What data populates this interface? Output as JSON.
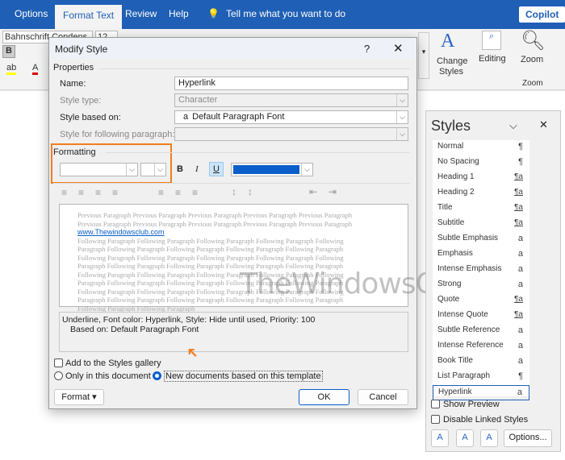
{
  "ribbon": {
    "tabs": [
      "Options",
      "Format Text",
      "Review",
      "Help"
    ],
    "tell_me": "Tell me what you want to do",
    "copilot": "Copilot",
    "font": "Bahnschrift Condens",
    "size": "12",
    "change_styles": "Change Styles",
    "editing": "Editing",
    "zoom": "Zoom",
    "zoom_group": "Zoom"
  },
  "dialog": {
    "title": "Modify Style",
    "help": "?",
    "properties": "Properties",
    "name_label": "Name:",
    "name_value": "Hyperlink",
    "type_label": "Style type:",
    "type_value": "Character",
    "based_label": "Style based on:",
    "based_value": "Default Paragraph Font",
    "based_icon": "a",
    "following_label": "Style for following paragraph:",
    "formatting": "Formatting",
    "bold": "B",
    "italic": "I",
    "underline": "U",
    "font_color": "#0a5ec9",
    "preview_prev": "Previous Paragraph Previous Paragraph Previous Paragraph Previous Paragraph Previous Paragraph Previous Paragraph Previous Paragraph Previous Paragraph Previous Paragraph Previous Paragraph",
    "preview_link": "www.Thewindowsclub.com",
    "preview_follow": "Following Paragraph Following Paragraph Following Paragraph Following Paragraph Following Paragraph Following Paragraph Following Paragraph Following Paragraph Following Paragraph Following Paragraph Following Paragraph Following Paragraph Following Paragraph Following Paragraph Following Paragraph Following Paragraph Following Paragraph Following Paragraph Following Paragraph Following Paragraph Following Paragraph Following Paragraph Following Paragraph Following Paragraph Following Paragraph Following Paragraph Following Paragraph Following Paragraph Following Paragraph Following Paragraph Following Paragraph Following Paragraph Following Paragraph Following Paragraph Following Paragraph Following Paragraph Following Paragraph Following Paragraph",
    "desc_line1": "Underline, Font color: Hyperlink, Style: Hide until used, Priority: 100",
    "desc_line2": "Based on: Default Paragraph Font",
    "add_gallery": "Add to the Styles gallery",
    "only_doc": "Only in this document",
    "new_docs": "New documents based on this template",
    "format": "Format",
    "ok": "OK",
    "cancel": "Cancel"
  },
  "watermark": "TheWindowsClub.com",
  "styles_pane": {
    "title": "Styles",
    "items": [
      {
        "name": "Normal",
        "glyph": "¶"
      },
      {
        "name": "No Spacing",
        "glyph": "¶"
      },
      {
        "name": "Heading 1",
        "glyph": "¶a"
      },
      {
        "name": "Heading 2",
        "glyph": "¶a"
      },
      {
        "name": "Title",
        "glyph": "¶a"
      },
      {
        "name": "Subtitle",
        "glyph": "¶a"
      },
      {
        "name": "Subtle Emphasis",
        "glyph": "a"
      },
      {
        "name": "Emphasis",
        "glyph": "a"
      },
      {
        "name": "Intense Emphasis",
        "glyph": "a"
      },
      {
        "name": "Strong",
        "glyph": "a"
      },
      {
        "name": "Quote",
        "glyph": "¶a"
      },
      {
        "name": "Intense Quote",
        "glyph": "¶a"
      },
      {
        "name": "Subtle Reference",
        "glyph": "a"
      },
      {
        "name": "Intense Reference",
        "glyph": "a"
      },
      {
        "name": "Book Title",
        "glyph": "a"
      },
      {
        "name": "List Paragraph",
        "glyph": "¶"
      },
      {
        "name": "Hyperlink",
        "glyph": "a"
      }
    ],
    "show_preview": "Show Preview",
    "disable_linked": "Disable Linked Styles",
    "options": "Options..."
  }
}
